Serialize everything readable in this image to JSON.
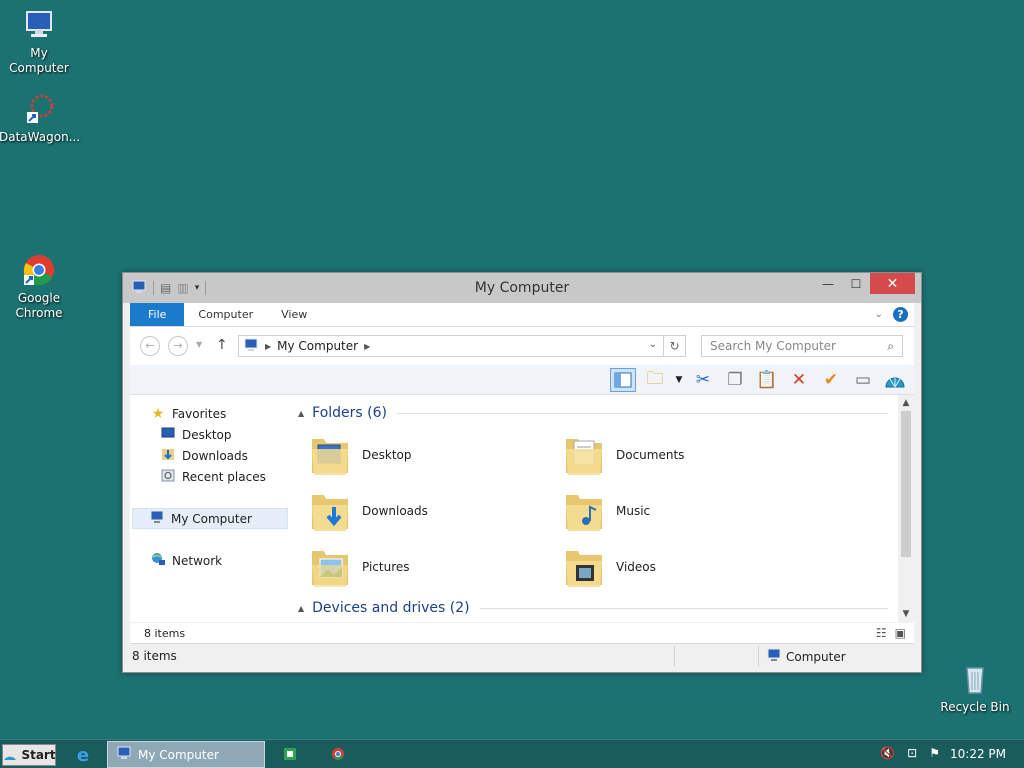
{
  "desktop": {
    "icons": [
      {
        "label": "My Computer"
      },
      {
        "label": "DataWagon..."
      },
      {
        "label": "Google Chrome"
      },
      {
        "label": "Recycle Bin"
      }
    ]
  },
  "window": {
    "title": "My Computer",
    "ribbon_tabs": [
      "File",
      "Computer",
      "View"
    ],
    "address": {
      "crumb": "My Computer"
    },
    "search": {
      "placeholder": "Search My Computer"
    },
    "nav": {
      "favorites": "Favorites",
      "items": [
        "Desktop",
        "Downloads",
        "Recent places"
      ],
      "my_computer": "My Computer",
      "network": "Network"
    },
    "groups": {
      "folders": "Folders (6)",
      "devices": "Devices and drives (2)"
    },
    "folders": [
      {
        "label": "Desktop"
      },
      {
        "label": "Documents"
      },
      {
        "label": "Downloads"
      },
      {
        "label": "Music"
      },
      {
        "label": "Pictures"
      },
      {
        "label": "Videos"
      }
    ],
    "items_count_inner": "8 items",
    "status": {
      "items": "8 items",
      "location": "Computer"
    }
  },
  "taskbar": {
    "start_label": "Start",
    "task_label": "My Computer",
    "clock": "10:22 PM"
  },
  "colors": {
    "desktop_bg": "#1c7271",
    "file_tab": "#1a7acb",
    "close_button": "#d54b4b"
  }
}
